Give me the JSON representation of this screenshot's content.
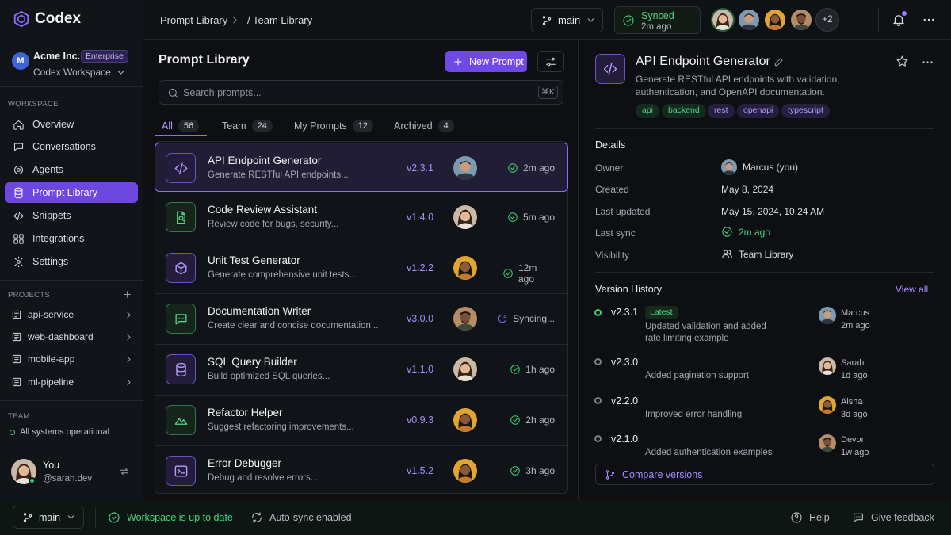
{
  "app": {
    "name": "Codex"
  },
  "workspace": {
    "avatar_letter": "M",
    "org": "Acme Inc.",
    "plan_badge": "Enterprise",
    "name": "Codex Workspace"
  },
  "sidebar": {
    "workspace_label": "WORKSPACE",
    "items": [
      {
        "label": "Overview",
        "icon": "home-icon"
      },
      {
        "label": "Conversations",
        "icon": "chat-icon"
      },
      {
        "label": "Agents",
        "icon": "agent-icon"
      },
      {
        "label": "Prompt Library",
        "icon": "database-icon",
        "active": true
      },
      {
        "label": "Snippets",
        "icon": "code-icon"
      },
      {
        "label": "Integrations",
        "icon": "grid-icon"
      },
      {
        "label": "Settings",
        "icon": "gear-icon"
      }
    ],
    "projects_label": "PROJECTS",
    "projects": [
      {
        "label": "api-service"
      },
      {
        "label": "web-dashboard"
      },
      {
        "label": "mobile-app"
      },
      {
        "label": "ml-pipeline"
      }
    ],
    "team_label": "TEAM",
    "team_status": "All systems operational",
    "user": {
      "name": "You",
      "handle": "@sarah.dev"
    }
  },
  "topbar": {
    "breadcrumb": [
      "Prompt Library",
      "/ Team Library"
    ],
    "branch": "main",
    "sync_title": "Synced",
    "sync_time": "2m ago",
    "more_collaborators": "+2"
  },
  "main": {
    "title": "Prompt Library",
    "new_button": "New Prompt",
    "search_placeholder": "Search prompts...",
    "search_shortcut": "⌘K",
    "tabs": [
      {
        "label": "All",
        "count": "56"
      },
      {
        "label": "Team",
        "count": "24"
      },
      {
        "label": "My Prompts",
        "count": "12"
      },
      {
        "label": "Archived",
        "count": "4"
      }
    ],
    "prompts": [
      {
        "name": "API Endpoint Generator",
        "desc": "Generate RESTful API endpoints...",
        "version": "v2.3.1",
        "status": "2m ago",
        "icon": "code-icon",
        "color": "purple",
        "state": "ok"
      },
      {
        "name": "Code Review Assistant",
        "desc": "Review code for bugs, security...",
        "version": "v1.4.0",
        "status": "5m ago",
        "icon": "file-search-icon",
        "color": "green",
        "state": "ok"
      },
      {
        "name": "Unit Test Generator",
        "desc": "Generate comprehensive unit tests...",
        "version": "v1.2.2",
        "status": "12m ago",
        "icon": "cube-icon",
        "color": "purple",
        "state": "ok"
      },
      {
        "name": "Documentation Writer",
        "desc": "Create clear and concise documentation...",
        "version": "v3.0.0",
        "status": "Syncing...",
        "icon": "message-icon",
        "color": "green",
        "state": "syncing"
      },
      {
        "name": "SQL Query Builder",
        "desc": "Build optimized SQL queries...",
        "version": "v1.1.0",
        "status": "1h ago",
        "icon": "database-icon",
        "color": "purple",
        "state": "ok"
      },
      {
        "name": "Refactor Helper",
        "desc": "Suggest refactoring improvements...",
        "version": "v0.9.3",
        "status": "2h ago",
        "icon": "mountain-icon",
        "color": "green",
        "state": "ok"
      },
      {
        "name": "Error Debugger",
        "desc": "Debug and resolve errors...",
        "version": "v1.5.2",
        "status": "3h ago",
        "icon": "terminal-icon",
        "color": "purple",
        "state": "ok"
      }
    ]
  },
  "detail": {
    "title": "API Endpoint Generator",
    "description": "Generate RESTful API endpoints with validation, authentication, and OpenAPI documentation.",
    "tags": [
      "api",
      "backend",
      "rest",
      "openapi",
      "typescript"
    ],
    "details_heading": "Details",
    "fields": [
      {
        "label": "Owner",
        "value": "Marcus (you)"
      },
      {
        "label": "Created",
        "value": "May 8, 2024"
      },
      {
        "label": "Last updated",
        "value": "May 15, 2024, 10:24 AM"
      },
      {
        "label": "Last sync",
        "value": "2m ago"
      },
      {
        "label": "Visibility",
        "value": "Team Library"
      }
    ],
    "history_heading": "Version History",
    "view_all": "View all",
    "latest_badge": "Latest",
    "versions": [
      {
        "version": "v2.3.1",
        "message": "Updated validation and added rate limiting example",
        "user": "Marcus",
        "time": "2m ago"
      },
      {
        "version": "v2.3.0",
        "message": "Added pagination support",
        "user": "Sarah",
        "time": "1d ago"
      },
      {
        "version": "v2.2.0",
        "message": "Improved error handling",
        "user": "Aisha",
        "time": "3d ago"
      },
      {
        "version": "v2.1.0",
        "message": "Added authentication examples",
        "user": "Devon",
        "time": "1w ago"
      }
    ],
    "compare_button": "Compare versions"
  },
  "statusbar": {
    "branch": "main",
    "workspace_status": "Workspace is up to date",
    "auto_sync": "Auto-sync enabled",
    "help": "Help",
    "feedback": "Give feedback"
  },
  "colors": {
    "accent": "#7048e8",
    "success": "#3fcf73",
    "background": "#0d0f12"
  }
}
